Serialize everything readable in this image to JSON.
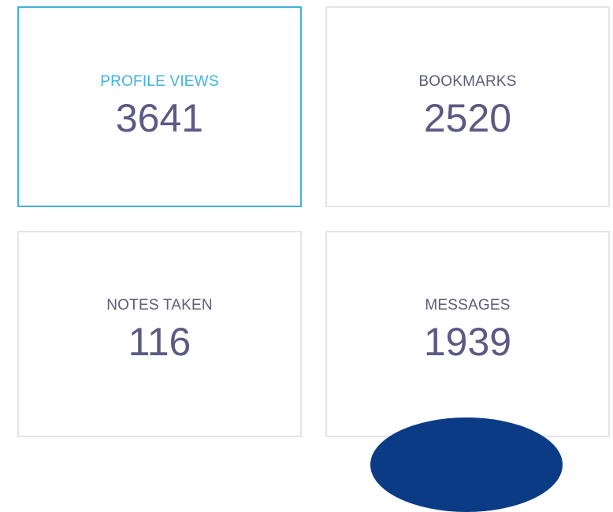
{
  "stats": {
    "profile_views": {
      "label": "PROFILE VIEWS",
      "value": "3641"
    },
    "bookmarks": {
      "label": "BOOKMARKS",
      "value": "2520"
    },
    "notes_taken": {
      "label": "NOTES TAKEN",
      "value": "116"
    },
    "messages": {
      "label": "MESSAGES",
      "value": "1939"
    }
  },
  "colors": {
    "active_accent": "#3fb3dc",
    "label_text": "#5a5c7a",
    "value_text": "#5c5a84",
    "card_border": "#e3e5ea",
    "floating_button": "#0c3b86"
  },
  "icons": {
    "floating_button": "circle-shape"
  }
}
